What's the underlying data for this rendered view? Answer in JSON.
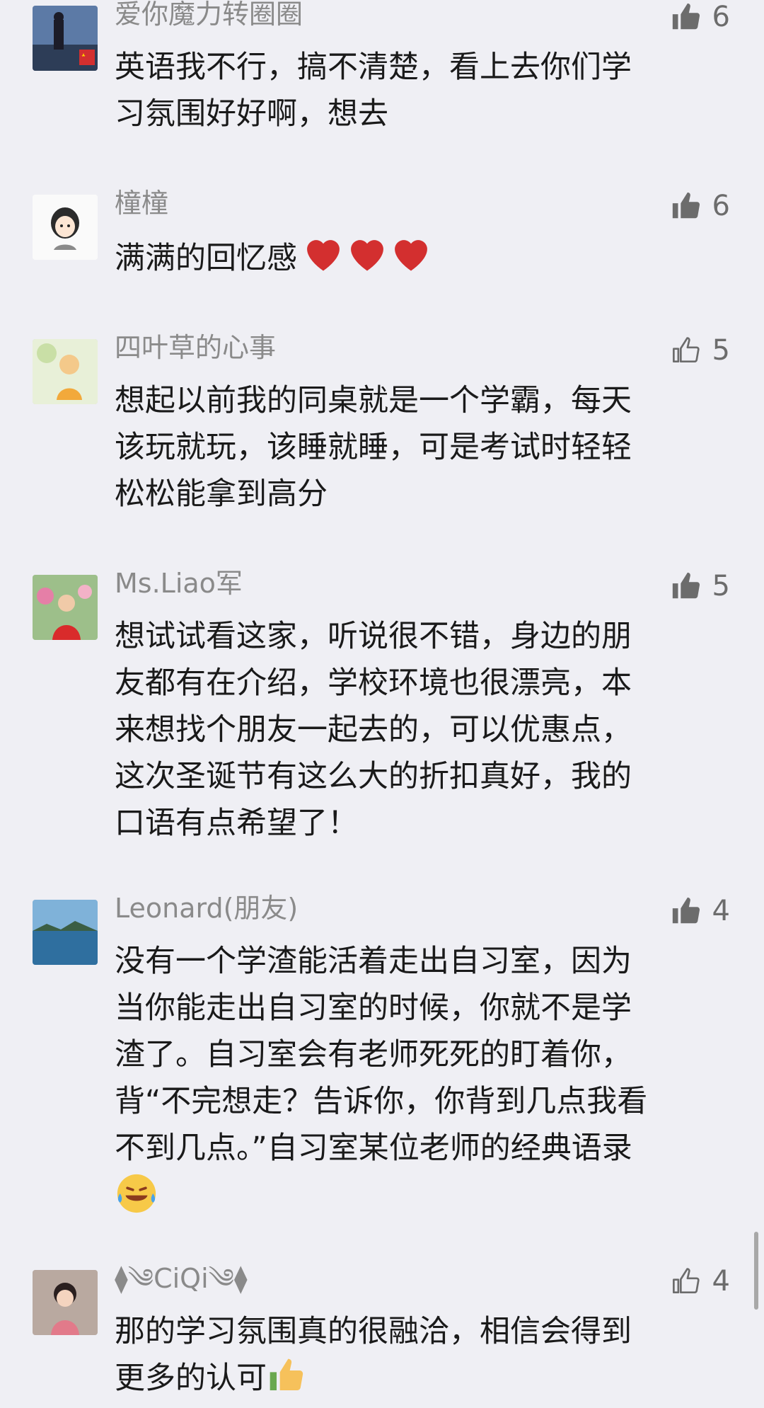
{
  "comments": [
    {
      "name": "爱你魔力转圈圈",
      "likes": "6",
      "liked": true,
      "text": "英语我不行，搞不清楚，看上去你们学\n习氛围好好啊，想去",
      "avatar": "avatar-night-city-icon"
    },
    {
      "name": "橦橦",
      "likes": "6",
      "liked": true,
      "text": "满满的回忆感",
      "emoji": "heart-icon",
      "avatar": "avatar-cartoon-girl-icon"
    },
    {
      "name": "四叶草的心事",
      "likes": "5",
      "liked": false,
      "text": "想起以前我的同桌就是一个学霸，每天\n该玩就玩，该睡就睡，可是考试时轻轻\n松松能拿到高分",
      "avatar": "avatar-illustrated-child-icon"
    },
    {
      "name": "Ms.Liao军",
      "likes": "5",
      "liked": true,
      "text": "想试试看这家，听说很不错，身边的朋\n友都有在介绍，学校环境也很漂亮，本\n来想找个朋友一起去的，可以优惠点，\n这次圣诞节有这么大的折扣真好，我的\n口语有点希望了！",
      "avatar": "avatar-woman-flowers-icon"
    },
    {
      "name": "Leonard(朋友)",
      "likes": "4",
      "liked": true,
      "text": "没有一个学渣能活着走出自习室，因为\n当你能走出自习室的时候，你就不是学\n渣了。自习室会有老师死死的盯着你，\n背“不完想走？告诉你，你背到几点我看\n不到几点。”自习室某位老师的经典语录\n",
      "emoji": "tears-of-joy-icon",
      "avatar": "avatar-lake-landscape-icon"
    },
    {
      "name": "⧫༄CiQi༄⧫",
      "likes": "4",
      "liked": false,
      "text": "那的学习氛围真的很融洽，相信会得到\n更多的认可",
      "emoji": "thumbs-up-emoji-icon",
      "avatar": "avatar-little-girl-icon"
    }
  ],
  "colors": {
    "background": "#efeff4",
    "like_icon": "#6c6c6c",
    "name": "#8a8a8a",
    "text": "#1a1a1a"
  }
}
